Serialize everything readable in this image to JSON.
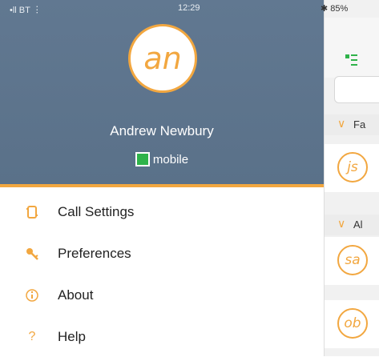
{
  "status_bar": {
    "carrier": "BT",
    "time": "12:29",
    "battery": "85%"
  },
  "profile": {
    "initials": "an",
    "name": "Andrew Newbury",
    "presence": "mobile"
  },
  "menu": [
    {
      "icon": "phone-settings-icon",
      "label": "Call Settings"
    },
    {
      "icon": "key-icon",
      "label": "Preferences"
    },
    {
      "icon": "info-icon",
      "label": "About"
    },
    {
      "icon": "question-icon",
      "label": "Help"
    }
  ],
  "contacts_panel": {
    "sections": [
      "Fa",
      "Al"
    ],
    "avatars": [
      "js",
      "sa",
      "ob"
    ]
  },
  "colors": {
    "accent": "#f2a740",
    "header": "#5f768f",
    "presence_green": "#2fb34a"
  }
}
